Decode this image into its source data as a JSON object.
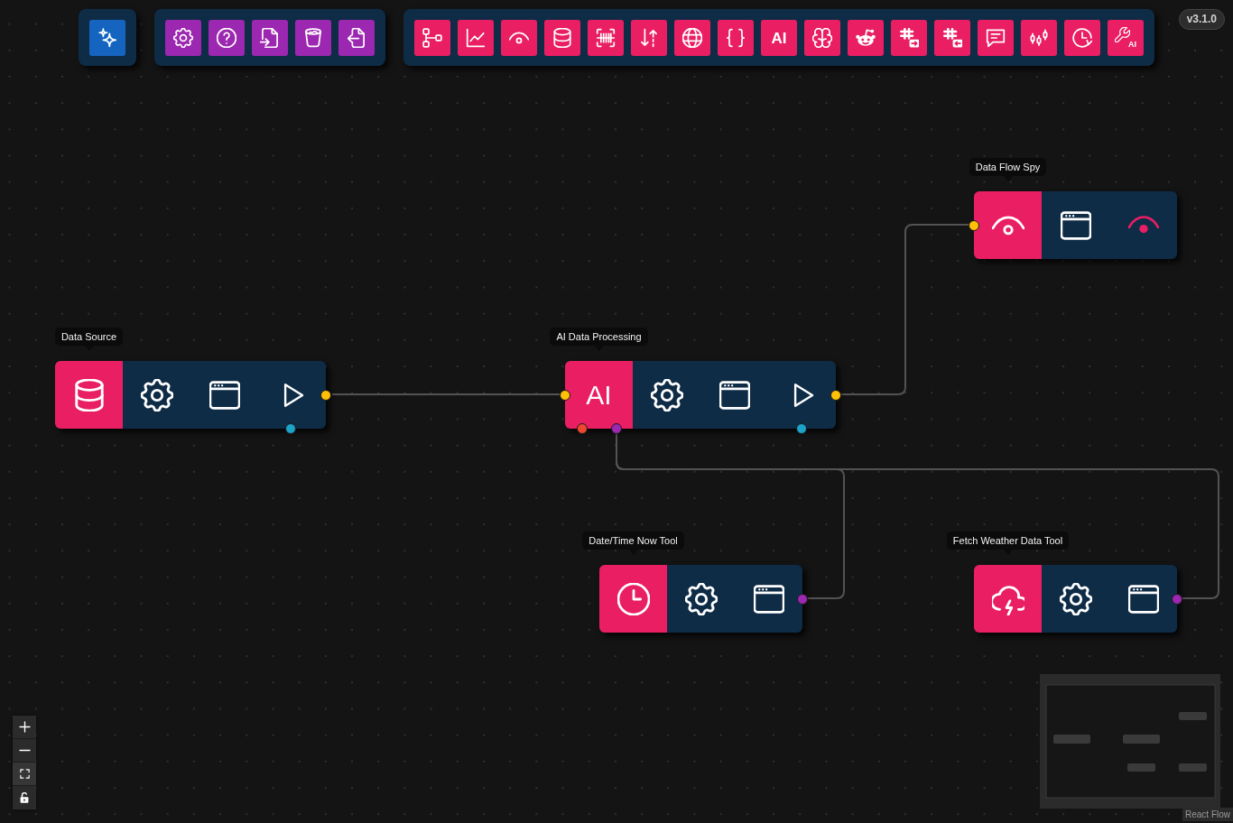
{
  "toolbar": {
    "groups": [
      {
        "buttons": [
          {
            "kind": "icon"
          }
        ]
      },
      {
        "buttons": [
          {
            "kind": "icon"
          },
          {
            "kind": "icon"
          },
          {
            "kind": "icon"
          },
          {
            "kind": "icon"
          },
          {
            "kind": "icon"
          }
        ]
      },
      {
        "buttons": [
          {
            "kind": "icon"
          },
          {
            "kind": "icon"
          },
          {
            "kind": "icon"
          },
          {
            "kind": "icon"
          },
          {
            "kind": "icon"
          },
          {
            "kind": "icon"
          },
          {
            "kind": "icon"
          },
          {
            "kind": "icon"
          },
          {
            "kind": "text",
            "label": "AI"
          },
          {
            "kind": "icon"
          },
          {
            "kind": "icon"
          },
          {
            "kind": "icon"
          },
          {
            "kind": "icon"
          },
          {
            "kind": "icon"
          },
          {
            "kind": "icon"
          },
          {
            "kind": "icon"
          },
          {
            "kind": "icon_text",
            "label": "AI"
          }
        ]
      }
    ],
    "version": "v3.1.0"
  },
  "nodes": [
    {
      "kind": "spy",
      "label": "Data Flow Spy",
      "handles": [
        {
          "color": "#ffc107"
        }
      ]
    },
    {
      "kind": "source",
      "label": "Data Source",
      "handles": [
        {
          "color": "#ffc107"
        },
        {
          "color": "#1ca3c8"
        }
      ]
    },
    {
      "kind": "ai",
      "label": "AI Data Processing",
      "badge": "AI",
      "handles": [
        {
          "color": "#ffc107"
        },
        {
          "color": "#ffc107"
        },
        {
          "color": "#ef4631"
        },
        {
          "color": "#9c27b0"
        },
        {
          "color": "#1ca3c8"
        }
      ]
    },
    {
      "kind": "clock",
      "label": "Date/Time Now Tool",
      "handles": [
        {
          "color": "#9c27b0"
        }
      ]
    },
    {
      "kind": "weather",
      "label": "Fetch Weather Data Tool",
      "handles": [
        {
          "color": "#9c27b0"
        }
      ]
    }
  ],
  "controls": {
    "locked": false
  },
  "attribution": "React Flow"
}
